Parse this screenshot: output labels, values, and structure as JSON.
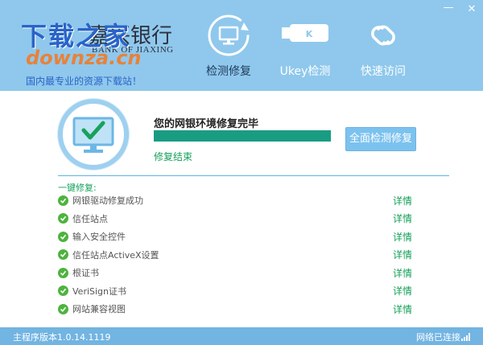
{
  "window": {
    "min_label": "—",
    "close_label": "✕"
  },
  "logo": {
    "watermark": "下载之家",
    "bank_name": "嘉兴银行",
    "bank_name_en": "BANK OF JIAXING",
    "watermark_domain": "downza.cn",
    "slogan": "国内最专业的资源下载站！"
  },
  "nav": {
    "items": [
      {
        "label": "检测修复",
        "icon": "monitor-refresh-icon",
        "active": true
      },
      {
        "label": "Ukey检测",
        "icon": "ukey-icon",
        "active": false
      },
      {
        "label": "快速访问",
        "icon": "link-icon",
        "active": false
      }
    ]
  },
  "status": {
    "title": "您的网银环境修复完毕",
    "progress_percent": 100,
    "subtitle": "修复结束",
    "repair_button": "全面检测修复"
  },
  "repair": {
    "section_title": "一键修复:",
    "items": [
      {
        "label": "网银驱动修复成功",
        "link": "详情"
      },
      {
        "label": "信任站点",
        "link": "详情"
      },
      {
        "label": "输入安全控件",
        "link": "详情"
      },
      {
        "label": "信任站点ActiveX设置",
        "link": "详情"
      },
      {
        "label": "根证书",
        "link": "详情"
      },
      {
        "label": "VeriSign证书",
        "link": "详情"
      },
      {
        "label": "网站兼容视图",
        "link": "详情"
      }
    ]
  },
  "footer": {
    "version": "主程序版本1.0.14.1119",
    "network": "网络已连接"
  },
  "colors": {
    "header": "#8fc8ec",
    "accent_green": "#14a05a",
    "progress": "#1a9c83",
    "footer": "#72b4e2"
  }
}
